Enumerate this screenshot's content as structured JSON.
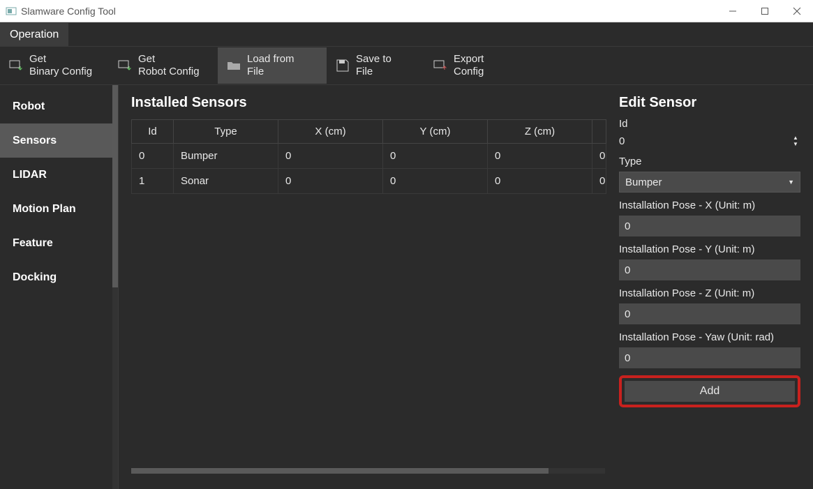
{
  "window": {
    "title": "Slamware Config Tool"
  },
  "menu": {
    "operation": "Operation"
  },
  "toolbar": {
    "getBinary": "Get\nBinary Config",
    "getRobot": "Get\nRobot Config",
    "loadFromFile": "Load from\nFile",
    "saveToFile": "Save to\nFile",
    "exportConfig": "Export\nConfig"
  },
  "sidebar": {
    "items": [
      {
        "label": "Robot"
      },
      {
        "label": "Sensors"
      },
      {
        "label": "LIDAR"
      },
      {
        "label": "Motion Plan"
      },
      {
        "label": "Feature"
      },
      {
        "label": "Docking"
      }
    ]
  },
  "table": {
    "title": "Installed Sensors",
    "headers": [
      "Id",
      "Type",
      "X (cm)",
      "Y (cm)",
      "Z (cm)",
      ""
    ],
    "rows": [
      {
        "id": "0",
        "type": "Bumper",
        "x": "0",
        "y": "0",
        "z": "0",
        "extra": "0"
      },
      {
        "id": "1",
        "type": "Sonar",
        "x": "0",
        "y": "0",
        "z": "0",
        "extra": "0"
      }
    ]
  },
  "edit": {
    "title": "Edit Sensor",
    "idLabel": "Id",
    "idValue": "0",
    "typeLabel": "Type",
    "typeValue": "Bumper",
    "poseXLabel": "Installation Pose - X (Unit: m)",
    "poseXValue": "0",
    "poseYLabel": "Installation Pose - Y (Unit: m)",
    "poseYValue": "0",
    "poseZLabel": "Installation Pose - Z (Unit: m)",
    "poseZValue": "0",
    "poseYawLabel": "Installation Pose - Yaw (Unit: rad)",
    "poseYawValue": "0",
    "addLabel": "Add"
  }
}
